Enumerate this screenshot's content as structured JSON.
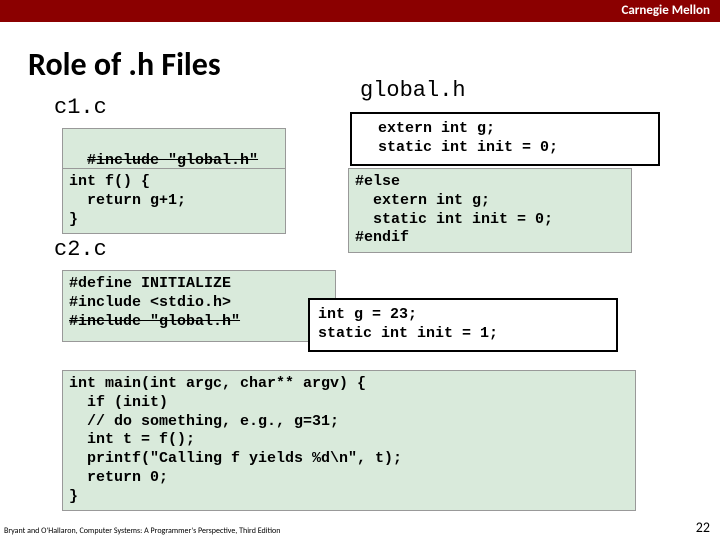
{
  "brand": "Carnegie Mellon",
  "title": "Role of .h Files",
  "labels": {
    "c1": "c1.c",
    "c2": "c2.c",
    "global": "global.h"
  },
  "code": {
    "c1_include": "#include \"global.h\"",
    "c1_body": "int f() {\n  return g+1;\n}",
    "global_top": "  extern int g;\n  static int init = 0;",
    "global_rest": "#else\n  extern int g;\n  static int init = 0;\n#endif",
    "c2_head": "#define INITIALIZE\n#include <stdio.h>",
    "c2_include": "#include \"global.h\"",
    "c2_overlay": "int g = 23;\nstatic int init = 1;",
    "c2_main": "int main(int argc, char** argv) {\n  if (init)\n  // do something, e.g., g=31;\n  int t = f();\n  printf(\"Calling f yields %d\\n\", t);\n  return 0;\n}"
  },
  "footer": "Bryant and O'Hallaron, Computer Systems: A Programmer's Perspective, Third Edition",
  "page": "22"
}
